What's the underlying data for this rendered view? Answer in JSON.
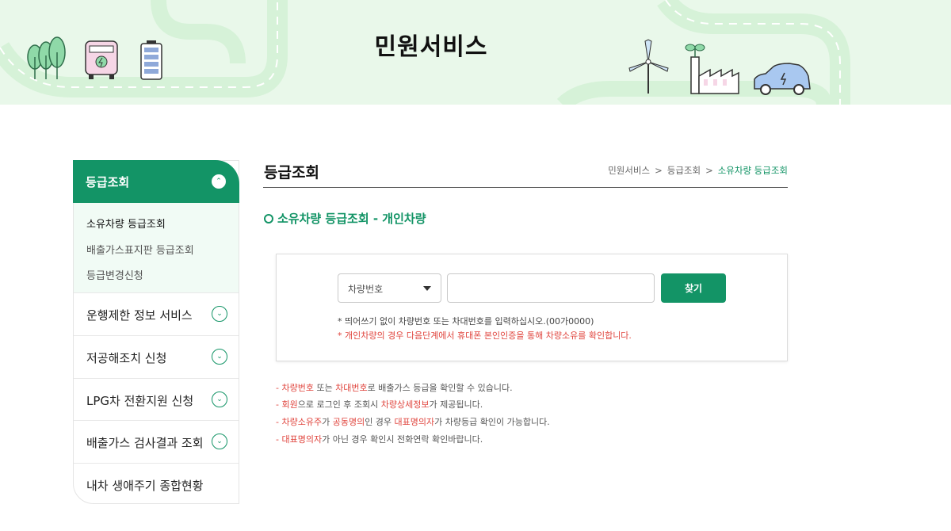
{
  "banner": {
    "title": "민원서비스",
    "colors": {
      "background": "#e9f8ea",
      "road": "#d6f2d8",
      "line": "#139466"
    },
    "icons": [
      "trees-icon",
      "electric-bus-icon",
      "battery-icon",
      "wind-turbine-icon",
      "factory-icon",
      "electric-car-icon"
    ]
  },
  "sidebar": {
    "header": {
      "label": "등급조회",
      "toggle": "⌃"
    },
    "sub_items": [
      {
        "label": "소유차량 등급조회"
      },
      {
        "label": "배출가스표지판 등급조회"
      },
      {
        "label": "등급변경신청"
      }
    ],
    "items": [
      {
        "label": "운행제한 정보 서비스",
        "toggle": "⌄"
      },
      {
        "label": "저공해조치 신청",
        "toggle": "⌄"
      },
      {
        "label": "LPG차 전환지원 신청",
        "toggle": "⌄"
      },
      {
        "label": "배출가스 검사결과 조회",
        "toggle": "⌄"
      },
      {
        "label": "내차 생애주기 종합현황",
        "toggle": ""
      }
    ]
  },
  "content": {
    "page_title": "등급조회",
    "breadcrumb": [
      {
        "label": "민원서비스"
      },
      {
        "label": "등급조회"
      },
      {
        "label": "소유차량 등급조회"
      }
    ],
    "breadcrumb_separator": ">",
    "section_title": "소유차량 등급조회 - 개인차량",
    "search": {
      "select_value": "차량번호",
      "input_value": "",
      "input_placeholder": "",
      "button_label": "찾기",
      "hint_1": "* 띄어쓰기 없이 차량번호 또는 차대번호를 입력하십시오.(00가0000)",
      "hint_2": "* 개인차량의 경우 다음단계에서 휴대폰 본인인증을 통해 차량소유를 확인합니다."
    },
    "notes": [
      {
        "dash": "- ",
        "parts": [
          {
            "t": "차량번호",
            "hl": true
          },
          {
            "t": " 또는 ",
            "hl": false
          },
          {
            "t": "차대번호",
            "hl": true
          },
          {
            "t": "로 배출가스 등급을 확인할 수 있습니다.",
            "hl": false
          }
        ]
      },
      {
        "dash": "- ",
        "parts": [
          {
            "t": "회원",
            "hl": true
          },
          {
            "t": "으로 로그인 후 조회시 ",
            "hl": false
          },
          {
            "t": "차량상세정보",
            "hl": true
          },
          {
            "t": "가 제공됩니다.",
            "hl": false
          }
        ]
      },
      {
        "dash": "- ",
        "parts": [
          {
            "t": "차량소유주",
            "hl": true
          },
          {
            "t": "가 ",
            "hl": false
          },
          {
            "t": "공동명의",
            "hl": true
          },
          {
            "t": "인 경우 ",
            "hl": false
          },
          {
            "t": "대표명의자",
            "hl": true
          },
          {
            "t": "가 차량등급 확인이 가능합니다.",
            "hl": false
          }
        ]
      },
      {
        "dash": "- ",
        "parts": [
          {
            "t": "대표명의자",
            "hl": true
          },
          {
            "t": "가 아닌 경우 확인시 전화연락 확인바랍니다.",
            "hl": false
          }
        ]
      }
    ],
    "accent_color": "#139466",
    "highlight_color": "#e0453e"
  }
}
